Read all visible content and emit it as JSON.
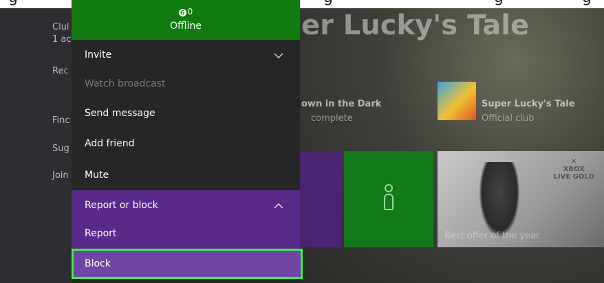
{
  "background": {
    "game_title": "er Lucky's Tale",
    "nav_items": [
      "Clul",
      "1 ac",
      "Rec",
      "Finc",
      "Sug",
      "Join"
    ],
    "tiles": {
      "game_progress": {
        "title": "own in the Dark",
        "subtitle": "complete"
      },
      "club": {
        "title": "Super Lucky's Tale",
        "subtitle": "Official club"
      },
      "gold": {
        "caption": "Best offer of the year",
        "brand_line1": "XBOX",
        "brand_line2": "LIVE GOLD"
      }
    }
  },
  "menu": {
    "header": {
      "gamerscore": "0",
      "gamerscore_icon": "G",
      "status": "Offline"
    },
    "items": [
      {
        "label": "Invite",
        "icon": "chevron-down-icon"
      },
      {
        "label": "Watch broadcast"
      },
      {
        "label": "Send message"
      },
      {
        "label": "Add friend"
      },
      {
        "label": "Mute"
      },
      {
        "label": "Report or block",
        "icon": "chevron-up-icon"
      },
      {
        "label": "Report"
      },
      {
        "label": "Block"
      }
    ]
  },
  "colors": {
    "header_green": "#107c10",
    "menu_bg": "#262626",
    "report_purple": "#5a2a8a",
    "block_purple": "#7045a6",
    "highlight": "#3ef04a"
  }
}
